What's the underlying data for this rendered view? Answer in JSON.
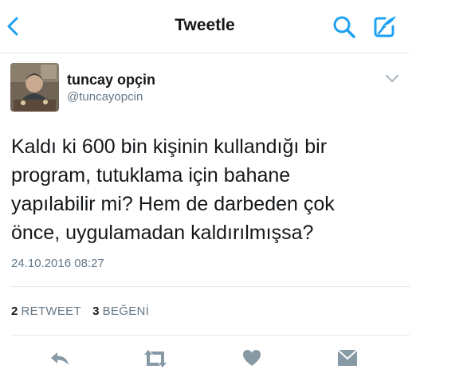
{
  "nav": {
    "title": "Tweetle",
    "back_icon": "chevron-left-icon",
    "search_icon": "search-icon",
    "compose_icon": "compose-tweet-icon"
  },
  "tweet": {
    "author_name": "tuncay opçin",
    "author_handle": "@tuncayopcin",
    "text_lines": [
      "Kaldı ki 600 bin kişinin kullandığı bir",
      "program, tutuklama için bahane",
      "yapılabilir mi? Hem de darbeden çok",
      "önce, uygulamadan kaldırılmışsa?"
    ],
    "timestamp": "24.10.2016 08:27"
  },
  "stats": {
    "retweets_count": "2",
    "retweets_label": "RETWEET",
    "likes_count": "3",
    "likes_label": "BEĞENİ"
  },
  "actions": [
    "reply-icon",
    "retweet-icon",
    "like-heart-icon",
    "direct-message-icon"
  ],
  "colors": {
    "accent": "#1da1f2",
    "text": "#14171a",
    "secondary": "#657786",
    "divider": "#e1e8ed",
    "action_icon": "#8899a6"
  }
}
